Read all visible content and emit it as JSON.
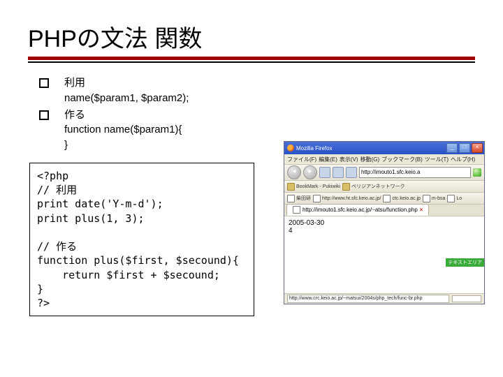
{
  "title": "PHPの文法 関数",
  "bullets": {
    "b1_label": "利用",
    "b1_line2": "name($param1, $param2);",
    "b2_label": "作る",
    "b2_line2": "function name($param1){",
    "b2_line3": "}"
  },
  "code": {
    "l1": "<?php",
    "l2": "// 利用",
    "l3": "print date('Y-m-d');",
    "l4": "print plus(1, 3);",
    "l5": "",
    "l6": "// 作る",
    "l7": "function plus($first, $secound){",
    "l8": "    return $first + $secound;",
    "l9": "}",
    "l10": "?>"
  },
  "browser": {
    "title": "Mozilla Firefox",
    "menu": {
      "file": "ファイル(F)",
      "edit": "編集(E)",
      "view": "表示(V)",
      "go": "移動(G)",
      "bookmarks": "ブックマーク(B)",
      "tools": "ツール(T)",
      "help": "ヘルプ(H)"
    },
    "url": "http://imouto1.sfc.keio.a",
    "bookmarks": {
      "b1": "BookMark - Pukiwiki",
      "b2": "ベリジアンネットワーク",
      "b3": "柴田研",
      "b4": "http://www.ht.sfc.keio.ac.jp/",
      "b5": "ctc.keio.ac.jp",
      "b6": "m-bsa",
      "b7": "Lo"
    },
    "tab": {
      "label": "http://imouto1.sfc.keio.ac.jp/~atsu/function.php"
    },
    "content": {
      "line1": "2005-03-30",
      "line2": "4"
    },
    "green": "テキストエリア",
    "status_url": "http://www.crc.keio.ac.jp/~matsui/2004s/php_tech/func-br.php"
  }
}
